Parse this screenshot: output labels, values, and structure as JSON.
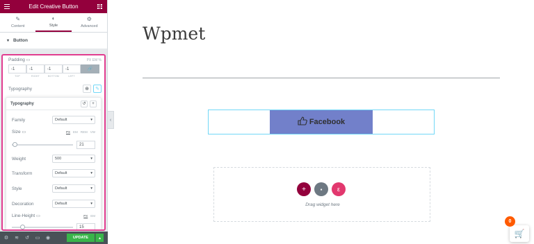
{
  "panel": {
    "title": "Edit Creative Button",
    "tabs": [
      {
        "label": "Content",
        "icon": "pencil-icon"
      },
      {
        "label": "Style",
        "icon": "contrast-icon"
      },
      {
        "label": "Advanced",
        "icon": "gear-icon"
      }
    ],
    "active_tab": "Style",
    "section": "Button",
    "padding": {
      "label": "Padding",
      "unit_labels": "PX EM %",
      "values": [
        "-1",
        "-1",
        "-1",
        "-1"
      ],
      "sides": [
        "TOP",
        "RIGHT",
        "BOTTOM",
        "LEFT"
      ]
    },
    "typography_label": "Typography",
    "popover": {
      "title": "Typography",
      "family": {
        "label": "Family",
        "value": "Default"
      },
      "size": {
        "label": "Size",
        "units": [
          "PX",
          "EM",
          "REM",
          "VW"
        ],
        "value": "21",
        "slider_fraction": 0.05
      },
      "weight": {
        "label": "Weight",
        "value": "500"
      },
      "transform": {
        "label": "Transform",
        "value": "Default"
      },
      "style": {
        "label": "Style",
        "value": "Default"
      },
      "decoration": {
        "label": "Decoration",
        "value": "Default"
      },
      "line_height": {
        "label": "Line-Height",
        "units": [
          "PX",
          "EM"
        ],
        "value": "15"
      }
    },
    "footer": {
      "update_label": "UPDATE"
    }
  },
  "canvas": {
    "site_title": "Wpmet",
    "button_label": "Facebook",
    "dropzone_text": "Drag widget here"
  },
  "notifications": {
    "count": "0"
  },
  "colors": {
    "brand": "#93003c",
    "highlight": "#e13c8f",
    "button_bg": "#7280ca",
    "update": "#39b54a"
  }
}
